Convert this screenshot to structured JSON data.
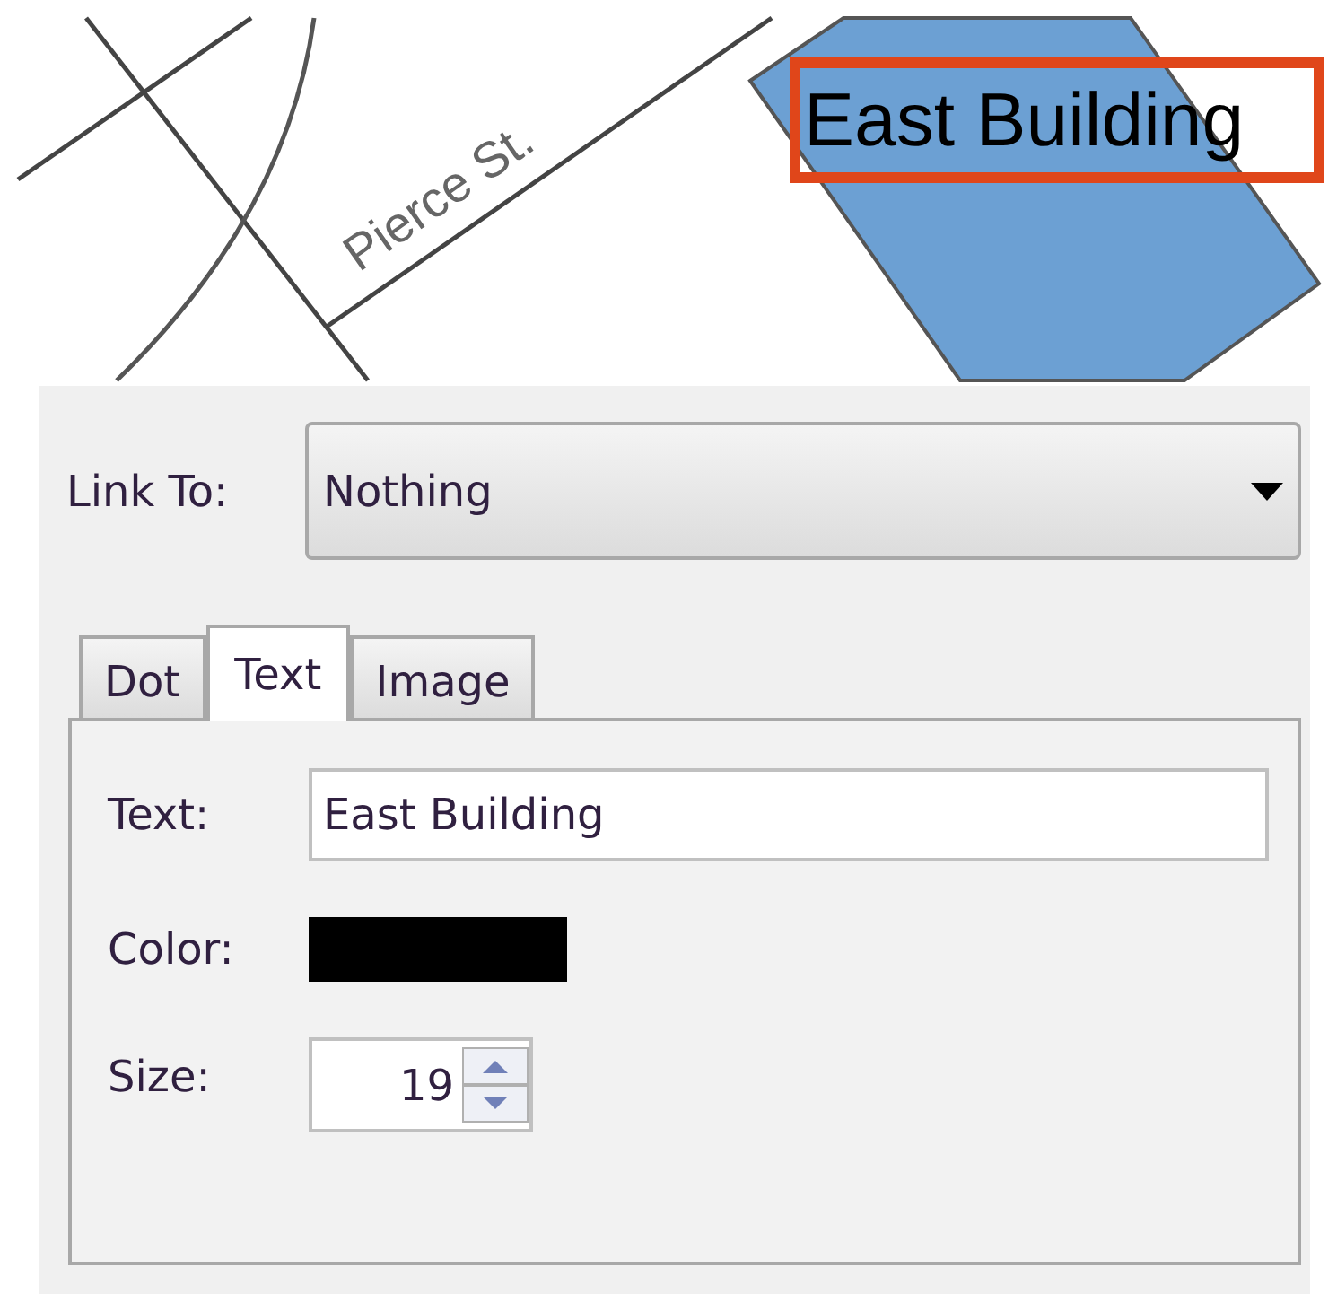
{
  "map": {
    "street_label": "Pierce St.",
    "selected_label": "East Building"
  },
  "link_to": {
    "label": "Link To:",
    "value": "Nothing"
  },
  "tabs": [
    {
      "label": "Dot",
      "selected": false
    },
    {
      "label": "Text",
      "selected": true
    },
    {
      "label": "Image",
      "selected": false
    }
  ],
  "text_tab": {
    "text_label": "Text:",
    "text_value": "East Building",
    "color_label": "Color:",
    "color": "#000000",
    "size_label": "Size:",
    "size_value": "19"
  }
}
